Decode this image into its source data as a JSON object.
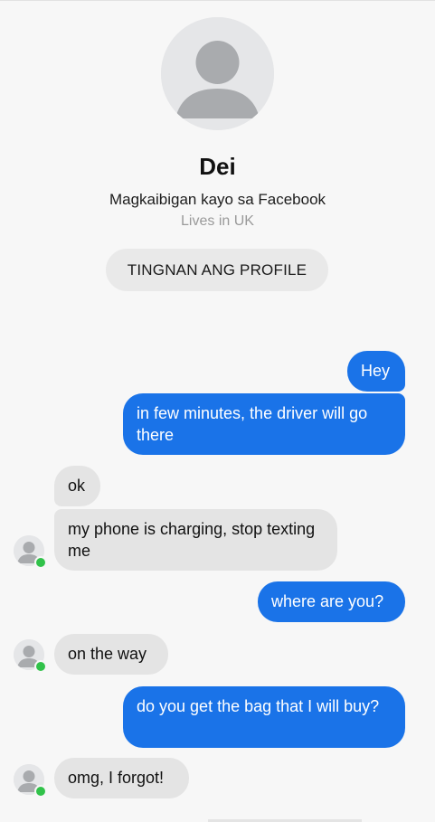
{
  "profile": {
    "name": "Dei",
    "friend_status": "Magkaibigan kayo sa Facebook",
    "location": "Lives in UK",
    "view_profile_label": "TINGNAN ANG PROFILE",
    "avatar_icon": "default-user-icon"
  },
  "messages": [
    {
      "sender": "me",
      "text": "Hey"
    },
    {
      "sender": "me",
      "text": "in few minutes, the driver will go there"
    },
    {
      "sender": "them",
      "text": "ok"
    },
    {
      "sender": "them",
      "text": "my phone is charging, stop texting me"
    },
    {
      "sender": "me",
      "text": "where are you?"
    },
    {
      "sender": "them",
      "text": "on the way"
    },
    {
      "sender": "me",
      "text": "do you get the bag that I will buy?"
    },
    {
      "sender": "them",
      "text": "omg, I forgot!"
    }
  ],
  "colors": {
    "outgoing_bubble": "#1a73e8",
    "incoming_bubble": "#e4e4e4",
    "online_indicator": "#31c24a",
    "background": "#f7f7f7"
  }
}
